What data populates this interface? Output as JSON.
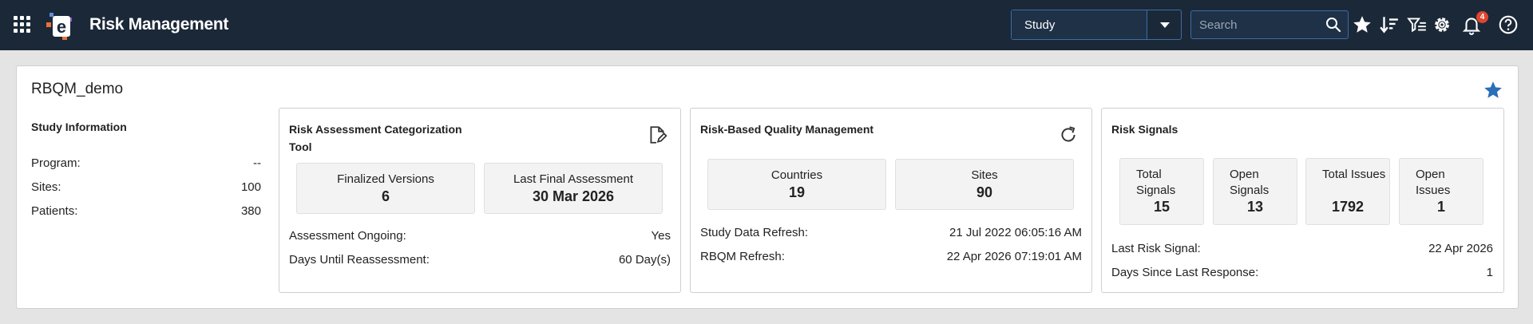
{
  "header": {
    "title": "Risk Management",
    "study_select_value": "Study",
    "search_placeholder": "Search",
    "notification_count": "4",
    "colors": {
      "bar": "#1b2838",
      "accent": "#2a6fb8",
      "badge": "#e0452f"
    }
  },
  "study": {
    "name": "RBQM_demo",
    "info_title": "Study Information",
    "rows": [
      {
        "label": "Program:",
        "value": "--"
      },
      {
        "label": "Sites:",
        "value": "100"
      },
      {
        "label": "Patients:",
        "value": "380"
      }
    ]
  },
  "ract": {
    "title": "Risk Assessment Categorization Tool",
    "stats": [
      {
        "label": "Finalized Versions",
        "value": "6"
      },
      {
        "label": "Last Final Assessment",
        "value": "30 Mar 2026"
      }
    ],
    "rows": [
      {
        "label": "Assessment Ongoing:",
        "value": "Yes"
      },
      {
        "label": "Days Until Reassessment:",
        "value": "60 Day(s)"
      }
    ]
  },
  "rbqm": {
    "title": "Risk-Based Quality Management",
    "stats": [
      {
        "label": "Countries",
        "value": "19"
      },
      {
        "label": "Sites",
        "value": "90"
      }
    ],
    "rows": [
      {
        "label": "Study Data Refresh:",
        "value": "21 Jul 2022 06:05:16 AM"
      },
      {
        "label": "RBQM Refresh:",
        "value": "22 Apr 2026 07:19:01 AM"
      }
    ]
  },
  "signals": {
    "title": "Risk Signals",
    "stats": [
      {
        "label": "Total Signals",
        "value": "15"
      },
      {
        "label": "Open Signals",
        "value": "13"
      },
      {
        "label": "Total Issues",
        "value": "1792"
      },
      {
        "label": "Open Issues",
        "value": "1"
      }
    ],
    "rows": [
      {
        "label": "Last Risk Signal:",
        "value": "22 Apr 2026"
      },
      {
        "label": "Days Since Last Response:",
        "value": "1"
      }
    ]
  }
}
